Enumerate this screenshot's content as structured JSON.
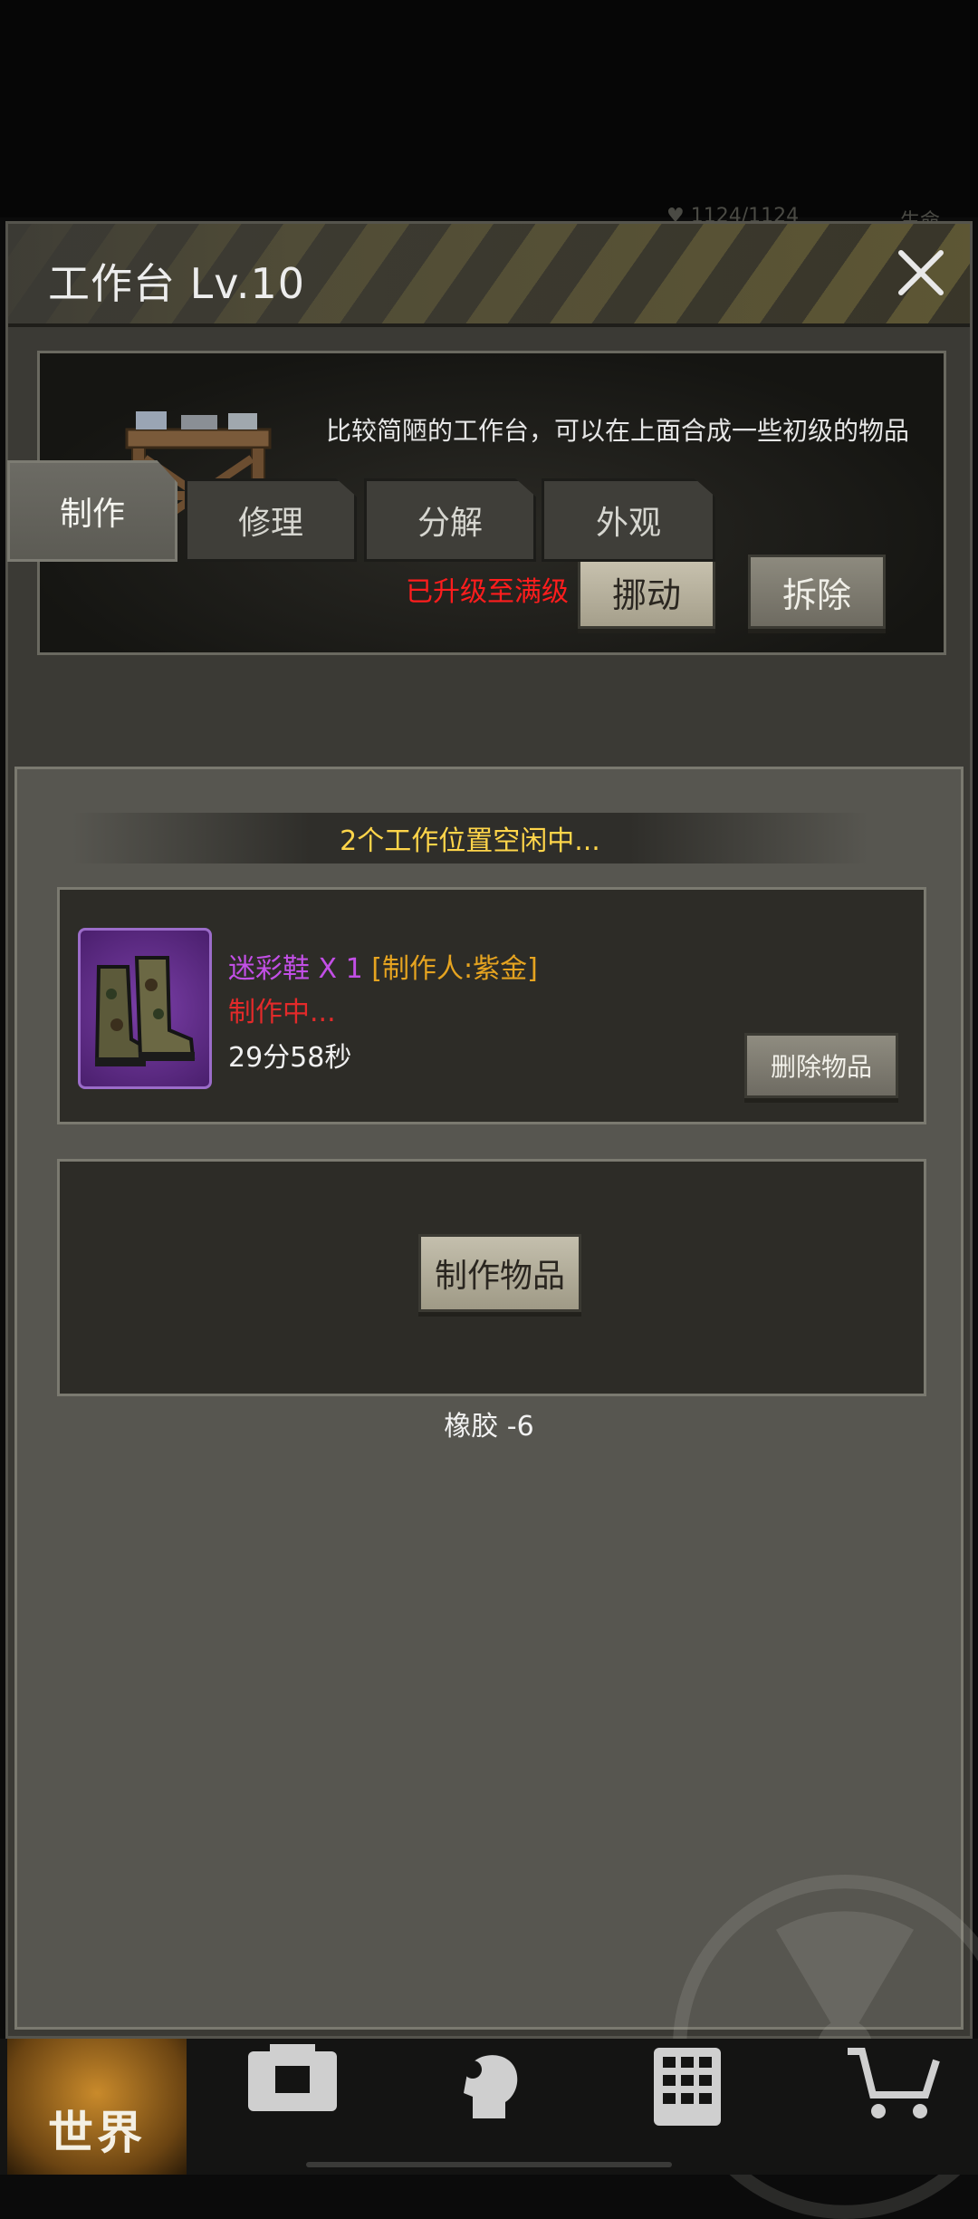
{
  "status_peek": {
    "hp": "1124/1124",
    "label": "生命"
  },
  "panel": {
    "title": "工作台 Lv.10"
  },
  "info": {
    "description": "比较简陋的工作台，可以在上面合成一些初级的物品",
    "max_level_text": "已升级至满级",
    "move_button": "挪动",
    "demolish_button": "拆除"
  },
  "tabs": [
    {
      "label": "制作",
      "active": true
    },
    {
      "label": "修理",
      "active": false
    },
    {
      "label": "分解",
      "active": false
    },
    {
      "label": "外观",
      "active": false
    }
  ],
  "slots_status": "2个工作位置空闲中...",
  "craft_item": {
    "name": "迷彩鞋",
    "quantity": "X 1",
    "maker": "[制作人:紫金]",
    "status": "制作中...",
    "remaining": "29分58秒",
    "delete_button": "删除物品"
  },
  "empty_slot": {
    "make_button": "制作物品",
    "material_hint": "橡胶 -6"
  },
  "bottom_nav": {
    "world_label": "世界",
    "items": [
      "backpack-icon",
      "character-icon",
      "building-icon",
      "shop-icon"
    ]
  },
  "colors": {
    "accent_yellow": "#ffd54a",
    "warning_red": "#ff1d1d",
    "item_purple": "#c24fe6",
    "maker_gold": "#e6a420"
  }
}
